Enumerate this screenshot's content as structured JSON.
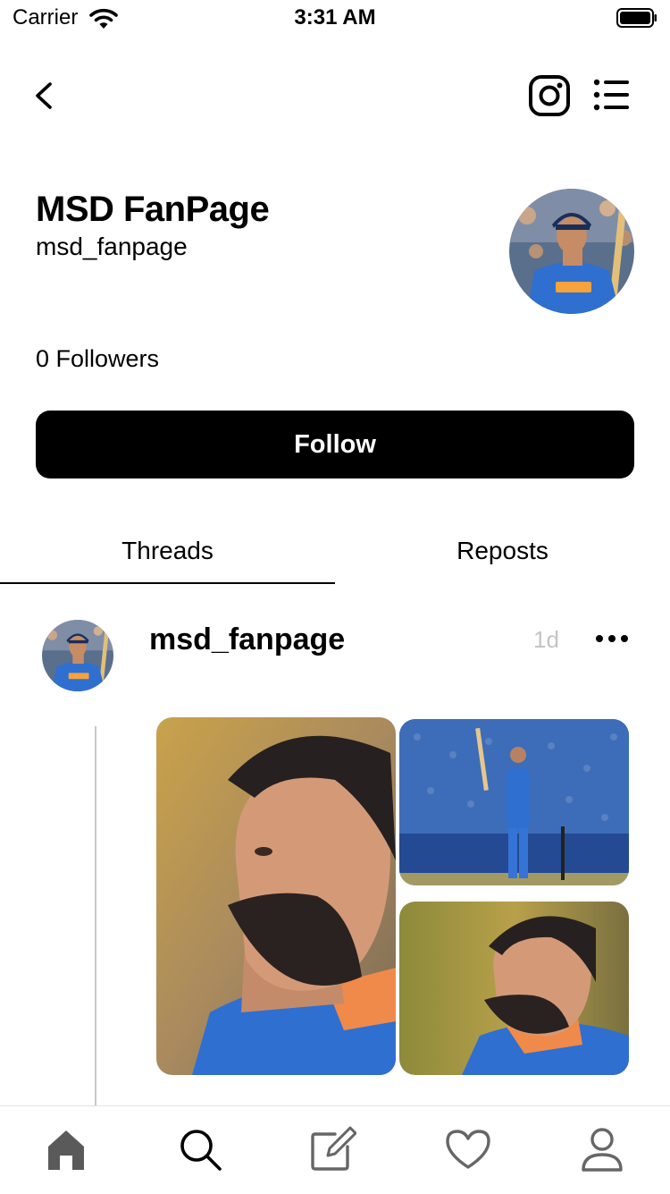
{
  "status_bar": {
    "carrier": "Carrier",
    "time": "3:31 AM"
  },
  "nav": {
    "back_icon": "chevron-left-icon",
    "instagram_icon": "instagram-icon",
    "menu_icon": "list-menu-icon"
  },
  "profile": {
    "name": "MSD FanPage",
    "handle": "msd_fanpage",
    "followers": "0 Followers",
    "follow_label": "Follow"
  },
  "tabs": [
    {
      "label": "Threads",
      "active": true
    },
    {
      "label": "Reposts",
      "active": false
    }
  ],
  "post": {
    "username": "msd_fanpage",
    "time": "1d",
    "more_icon": "more-horizontal-icon"
  },
  "tabbar": {
    "items": [
      "home-icon",
      "search-icon",
      "compose-icon",
      "heart-icon",
      "profile-icon"
    ],
    "active": "home-icon"
  },
  "colors": {
    "accent": "#000000",
    "jersey_blue": "#2f6fd0",
    "muted": "#c4c4c4"
  }
}
